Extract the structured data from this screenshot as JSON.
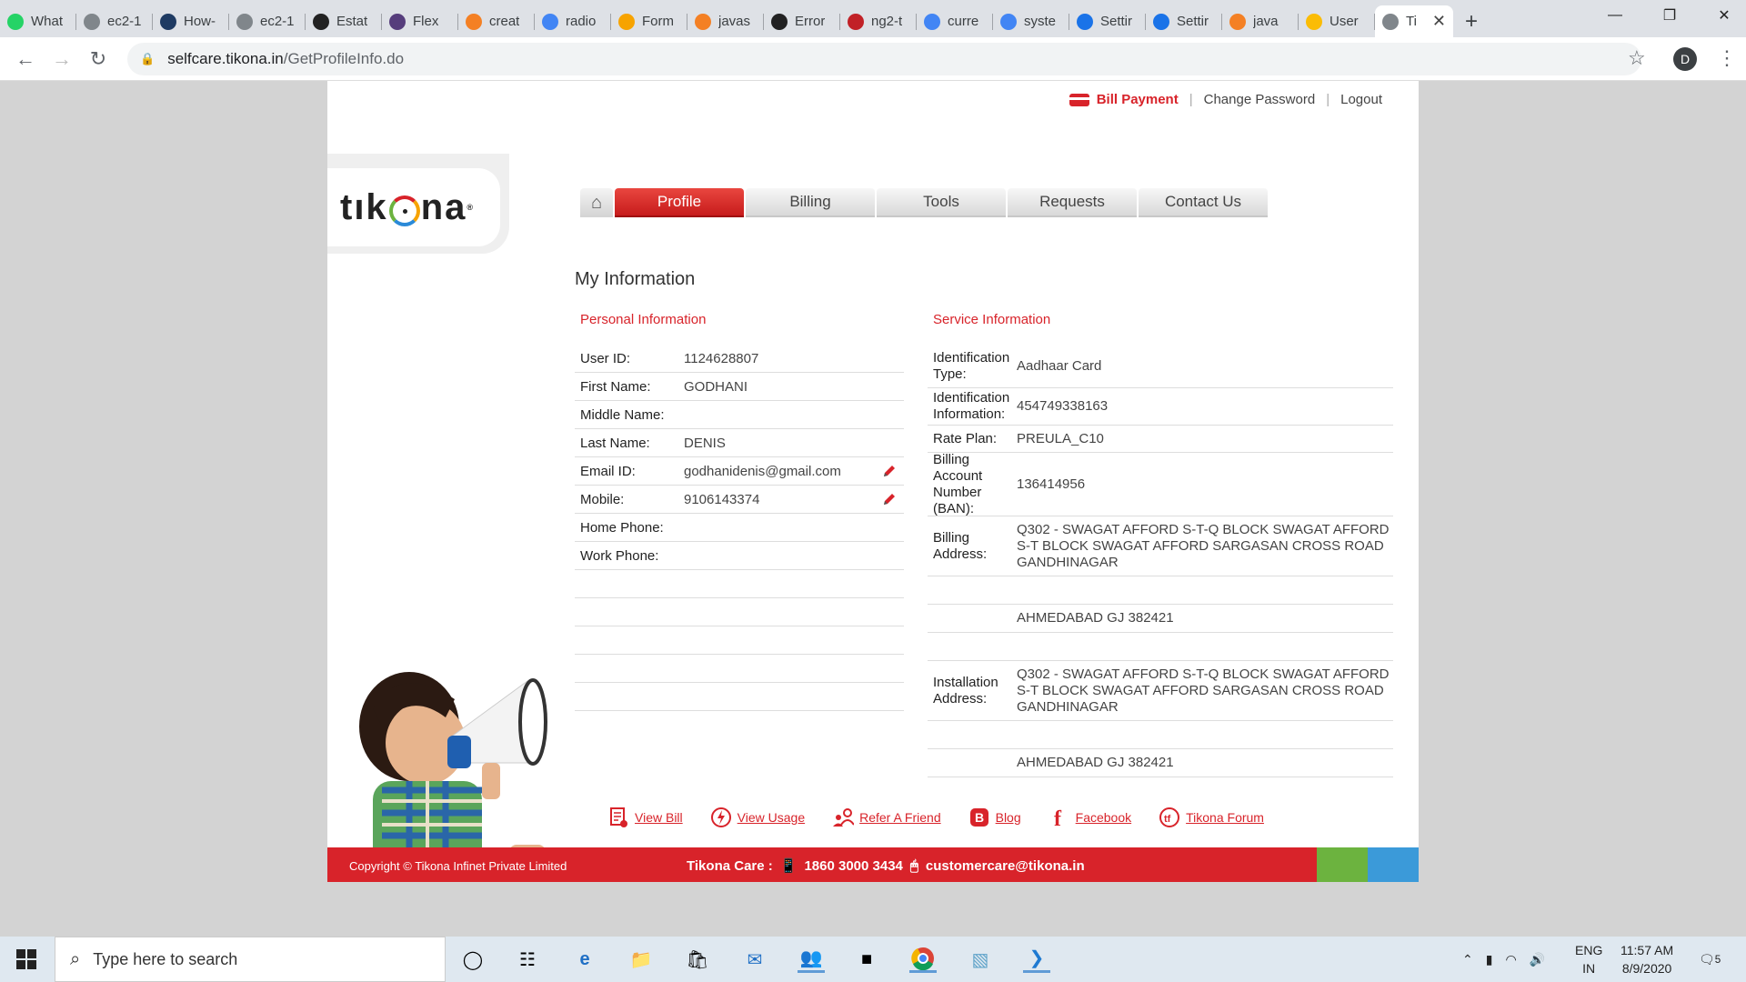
{
  "browser": {
    "tabs": [
      {
        "label": "What",
        "color": "#25d366"
      },
      {
        "label": "ec2-1",
        "color": "#80868b"
      },
      {
        "label": "How-",
        "color": "#1f3b63"
      },
      {
        "label": "ec2-1",
        "color": "#80868b"
      },
      {
        "label": "Estat",
        "color": "#222"
      },
      {
        "label": "Flex",
        "color": "#563d7c"
      },
      {
        "label": "creat",
        "color": "#f48024"
      },
      {
        "label": "radio",
        "color": "#4285f4"
      },
      {
        "label": "Form",
        "color": "#f7a300"
      },
      {
        "label": "javas",
        "color": "#f48024"
      },
      {
        "label": "Error",
        "color": "#222"
      },
      {
        "label": "ng2-t",
        "color": "#c12127"
      },
      {
        "label": "curre",
        "color": "#4285f4"
      },
      {
        "label": "syste",
        "color": "#4285f4"
      },
      {
        "label": "Settir",
        "color": "#1a73e8"
      },
      {
        "label": "Settir",
        "color": "#1a73e8"
      },
      {
        "label": "java",
        "color": "#f48024"
      },
      {
        "label": "User",
        "color": "#fbbc05"
      }
    ],
    "active_tab": {
      "label": "Ti"
    },
    "url_domain": "selfcare.tikona.in",
    "url_path": "/GetProfileInfo.do",
    "avatar_letter": "D"
  },
  "header": {
    "bill_payment": "Bill Payment",
    "change_password": "Change Password",
    "logout": "Logout",
    "sep": "|",
    "brand": {
      "pre": "tık",
      "post": "na",
      "reg": "®"
    }
  },
  "nav": {
    "tabs": [
      "Profile",
      "Billing",
      "Tools",
      "Requests",
      "Contact Us"
    ],
    "active": "Profile"
  },
  "main": {
    "title": "My Information",
    "personal_heading": "Personal Information",
    "service_heading": "Service Information",
    "personal": [
      {
        "label": "User ID:",
        "value": "1124628807"
      },
      {
        "label": "First Name:",
        "value": "GODHANI"
      },
      {
        "label": "Middle Name:",
        "value": ""
      },
      {
        "label": "Last Name:",
        "value": "DENIS"
      },
      {
        "label": "Email ID:",
        "value": "godhanidenis@gmail.com"
      },
      {
        "label": "Mobile:",
        "value": "9106143374"
      },
      {
        "label": "Home Phone:",
        "value": ""
      },
      {
        "label": "Work Phone:",
        "value": ""
      }
    ],
    "service": [
      {
        "label": "Identification Type:",
        "value": "Aadhaar Card"
      },
      {
        "label": "Identification Information:",
        "value": "454749338163"
      },
      {
        "label": "Rate Plan:",
        "value": "PREULA_C10"
      },
      {
        "label": "Billing Account Number (BAN):",
        "value": "136414956"
      },
      {
        "label": "Billing Address:",
        "value": "Q302 - SWAGAT AFFORD S-T-Q BLOCK SWAGAT AFFORD S-T BLOCK SWAGAT AFFORD SARGASAN CROSS ROAD GANDHINAGAR"
      },
      {
        "label": "",
        "value": ""
      },
      {
        "label": "",
        "value": "AHMEDABAD GJ 382421"
      },
      {
        "label": "",
        "value": ""
      },
      {
        "label": "Installation Address:",
        "value": "Q302 - SWAGAT AFFORD S-T-Q BLOCK SWAGAT AFFORD S-T BLOCK SWAGAT AFFORD SARGASAN CROSS ROAD GANDHINAGAR"
      },
      {
        "label": "",
        "value": ""
      },
      {
        "label": "",
        "value": "AHMEDABAD GJ 382421"
      }
    ]
  },
  "footer_links": {
    "view_bill": "View Bill",
    "view_usage": "View Usage",
    "refer": "Refer A Friend",
    "blog": "Blog",
    "facebook": "Facebook",
    "forum": "Tikona Forum"
  },
  "footer": {
    "copyright": "Copyright © Tikona Infinet Private Limited",
    "care_label": "Tikona Care :",
    "phone": "1860 3000 3434",
    "email": "customercare@tikona.in"
  },
  "taskbar": {
    "search_placeholder": "Type here to search",
    "lang_top": "ENG",
    "lang_bottom": "IN",
    "time": "11:57 AM",
    "date": "8/9/2020",
    "notif_count": "5"
  },
  "colors": {
    "brand_red": "#d8232a",
    "green": "#6cb33f",
    "blue": "#3b9ad9"
  }
}
